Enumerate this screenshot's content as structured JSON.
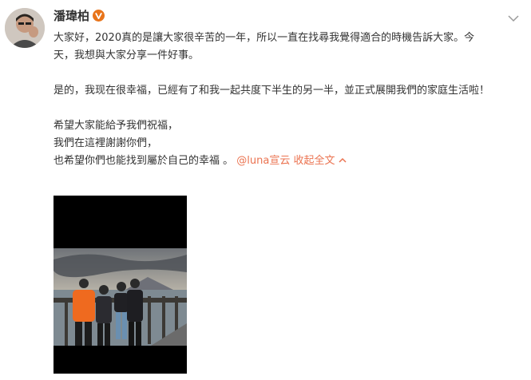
{
  "post": {
    "username": "潘瑋柏",
    "text_line_1": "大家好，2020真的是讓大家很辛苦的一年，所以一直在找尋我覺得適合的時機告訴大家。今",
    "text_line_2": "天，我想與大家分享一件好事。",
    "text_line_3": "是的，我现在很幸福，已經有了和我一起共度下半生的另一半，並正式展開我們的家庭生活啦！",
    "text_line_4": "希望大家能給予我們祝福，",
    "text_line_5": "我們在這裡謝謝你們，",
    "text_line_6": "也希望你們也能找到屬於自己的幸福 。",
    "mention": "@luna宣云",
    "collapse_label": "收起全文"
  },
  "colors": {
    "link": "#eb7350",
    "verified_badge": "#e8741a",
    "text": "#333333"
  },
  "icons": {
    "verified": "verified-v-icon",
    "more": "chevron-down-icon",
    "collapse": "chevron-up-icon"
  }
}
